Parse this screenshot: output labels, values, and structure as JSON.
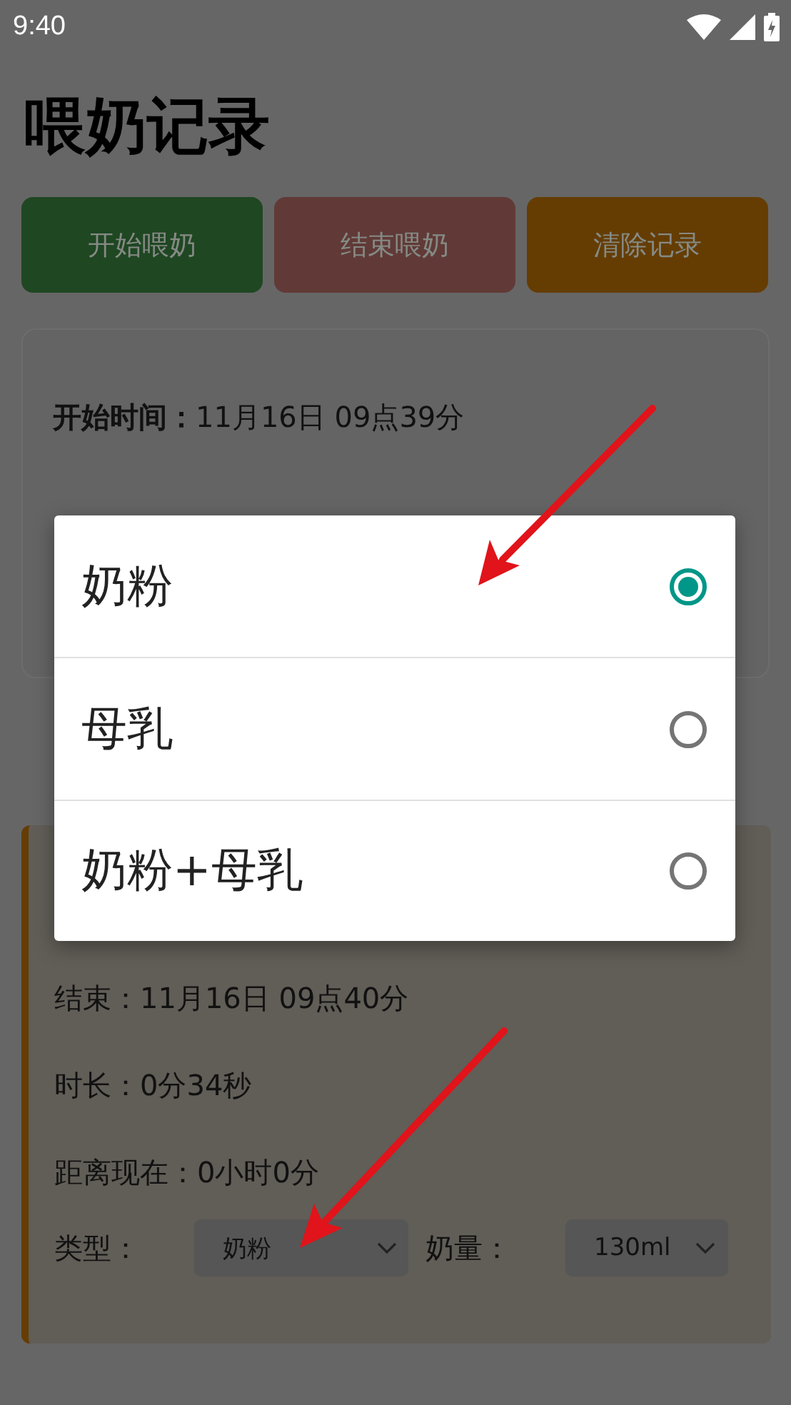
{
  "status_bar": {
    "time": "9:40"
  },
  "title": "喂奶记录",
  "buttons": [
    {
      "label": "开始喂奶",
      "color": "#1f4722"
    },
    {
      "label": "结束喂奶",
      "color": "#613a37"
    },
    {
      "label": "清除记录",
      "color": "#653d03"
    }
  ],
  "current": {
    "start": "**开始时间：**11月16日 09点39分"
  },
  "history": [
    {
      "end": "结束：11月16日 09点40分",
      "duration": "时长：0分34秒",
      "since": "距离现在：0小时0分",
      "type_label": "类型：",
      "type_value": "奶粉",
      "amount_label": "奶量：",
      "amount_value": "130ml"
    }
  ],
  "dialog": {
    "options": [
      {
        "label": "奶粉",
        "selected": true
      },
      {
        "label": "母乳",
        "selected": false
      },
      {
        "label": "奶粉+母乳",
        "selected": false
      }
    ]
  }
}
